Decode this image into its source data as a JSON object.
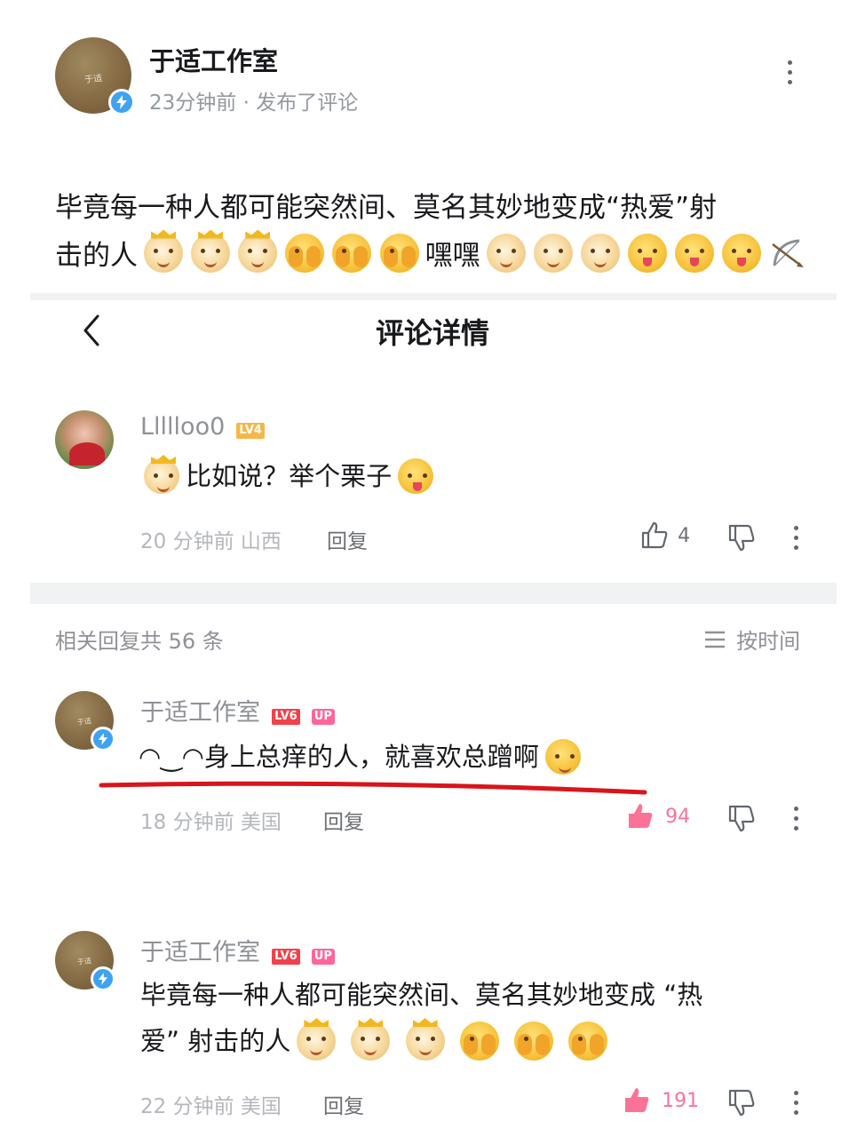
{
  "post": {
    "author": "于适工作室",
    "meta": "23分钟前 · 发布了评论",
    "avatar_text": "于适",
    "text_line1": "毕竟每一种人都可能突然间、莫名其妙地变成“热爱”射",
    "text_line2_a": "击的人",
    "text_line2_b": "嘿嘿"
  },
  "nav": {
    "title": "评论详情"
  },
  "main_comment": {
    "user": "Lllllοo0",
    "level": "LV4",
    "text": "比如说？举个栗子",
    "time_location": "20 分钟前  山西",
    "reply_label": "回复",
    "likes": "4"
  },
  "replies_bar": {
    "count_label": "相关回复共 56 条",
    "sort_label": "按时间"
  },
  "replies": [
    {
      "user": "于适工作室",
      "level": "LV6",
      "badge": "UP",
      "text": "◠‿◠身上总痒的人，就喜欢总蹭啊",
      "time_location": "18 分钟前  美国",
      "reply_label": "回复",
      "likes": "94"
    },
    {
      "user": "于适工作室",
      "level": "LV6",
      "badge": "UP",
      "text_line1": "毕竟每一种人都可能突然间、莫名其妙地变成 “热",
      "text_line2": "爱” 射击的人",
      "time_location": "22 分钟前  美国",
      "reply_label": "回复",
      "likes": "191"
    }
  ],
  "colors": {
    "accent_pink": "#fb7299",
    "verify_blue": "#3ea3f2",
    "underline_red": "#d9141b",
    "level6": "#f0424c",
    "level4": "#f5b74b"
  }
}
